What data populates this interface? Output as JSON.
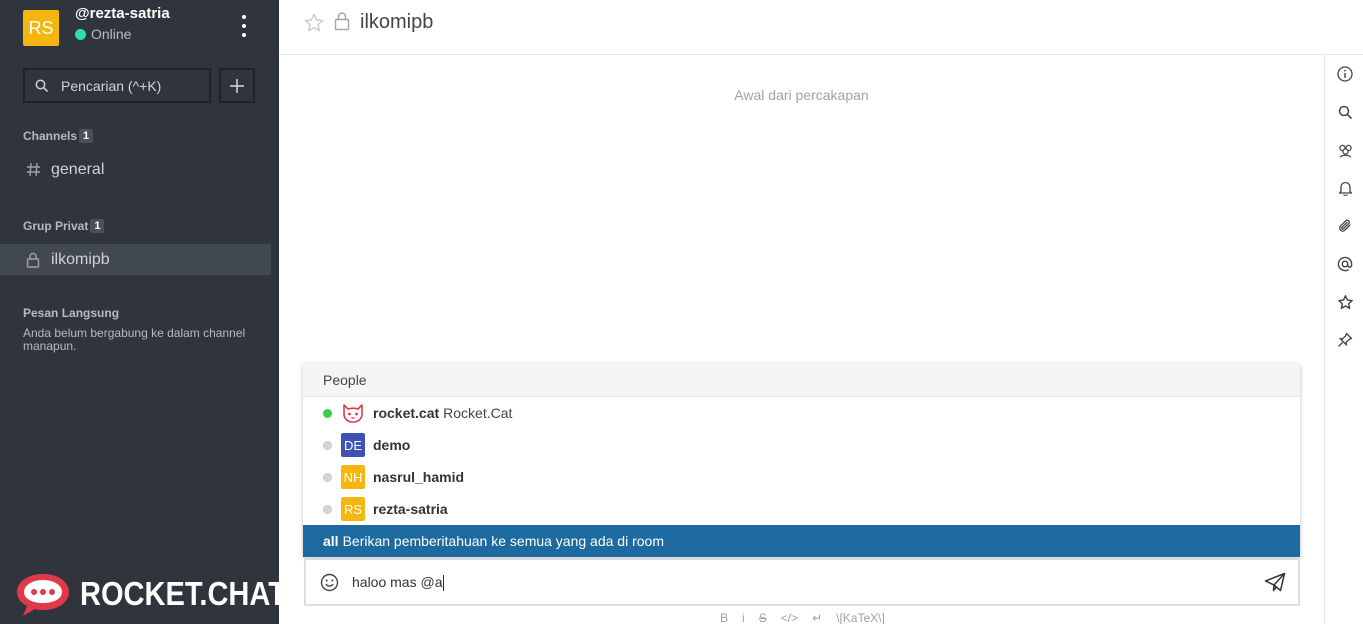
{
  "user": {
    "initials": "RS",
    "username": "@rezta-satria",
    "status": "Online"
  },
  "search": {
    "placeholder": "Pencarian (^+K)"
  },
  "sections": {
    "channels": {
      "title": "Channels",
      "count": "1",
      "items": [
        {
          "label": "general"
        }
      ]
    },
    "private_groups": {
      "title": "Grup Privat",
      "count": "1",
      "items": [
        {
          "label": "ilkomipb"
        }
      ]
    },
    "direct_messages": {
      "title": "Pesan Langsung",
      "empty_note": "Anda belum bergabung ke dalam channel manapun."
    }
  },
  "brand": {
    "text": "ROCKET.CHAT"
  },
  "room": {
    "title": "ilkomipb",
    "start_message": "Awal dari percakapan"
  },
  "right_bar_icons": [
    "info-icon",
    "search-icon",
    "members-icon",
    "bell-icon",
    "attachment-icon",
    "mention-icon",
    "star-icon",
    "pin-icon"
  ],
  "popup": {
    "header": "People",
    "people": [
      {
        "username": "rocket.cat",
        "name": "Rocket.Cat",
        "status": "online",
        "avatar": "cat"
      },
      {
        "username": "demo",
        "name": "",
        "status": "offline",
        "avatar_initials": "DE",
        "avatar_color": "#3f51b5"
      },
      {
        "username": "nasrul_hamid",
        "name": "",
        "status": "offline",
        "avatar_initials": "NH",
        "avatar_color": "#f5b70f"
      },
      {
        "username": "rezta-satria",
        "name": "",
        "status": "offline",
        "avatar_initials": "RS",
        "avatar_color": "#f5b70f"
      }
    ],
    "all": {
      "keyword": "all",
      "description": "Berikan pemberitahuan ke semua yang ada di room"
    }
  },
  "composer": {
    "text": "haloo mas @a"
  },
  "format_bar": {
    "bold": "B",
    "italic": "i",
    "strike": "S",
    "code": "</>",
    "multiline": "↵",
    "katex": "\\[KaTeX\\]"
  },
  "colors": {
    "sidebar": "#2f343d",
    "selected": "#1d6aa0",
    "online": "#2de0a5",
    "avatar_yellow": "#f5b70f",
    "avatar_blue": "#3f51b5"
  }
}
